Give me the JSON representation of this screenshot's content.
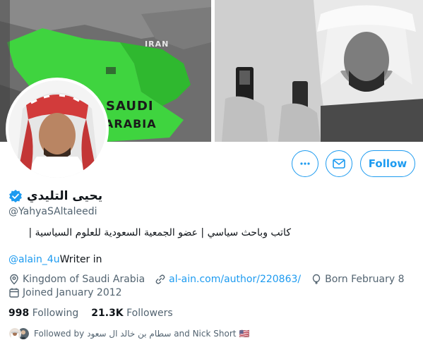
{
  "banner": {
    "map_labels": [
      "IRAN",
      "SAUDI",
      "ARABIA"
    ]
  },
  "profile": {
    "display_name": "يحيى التليدي",
    "handle": "@YahyaSAltaleedi",
    "bio": "كاتب وباحث سياسي | عضو الجمعية السعودية للعلوم السياسية |",
    "mention": "@alain_4u",
    "writer_in": "Writer in",
    "location": "Kingdom of Saudi Arabia",
    "website": "al-ain.com/author/220863/",
    "birthday": "Born February 8",
    "joined": "Joined January 2012",
    "following_count": "998",
    "following_label": "Following",
    "followers_count": "21.3K",
    "followers_label": "Followers",
    "followed_by_prefix": "Followed by",
    "followed_by_names": "سطام بن خالد ال سعود and Nick Short",
    "flag": "🇺🇸"
  },
  "actions": {
    "more_icon": "more-icon",
    "message_icon": "envelope-icon",
    "follow_label": "Follow"
  },
  "colors": {
    "accent": "#1d9bf0",
    "text": "#0f1419",
    "muted": "#536471",
    "verified": "#1d9bf0"
  }
}
